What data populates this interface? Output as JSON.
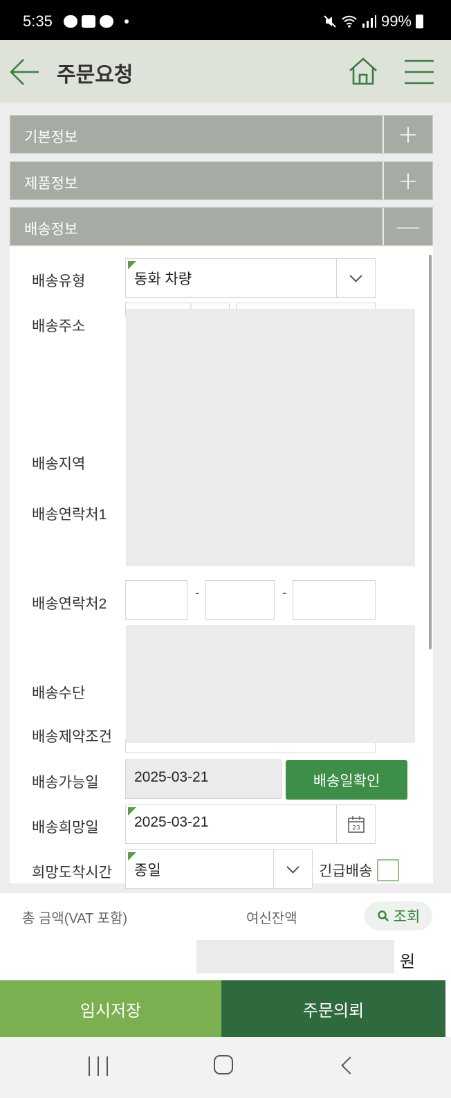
{
  "status_bar": {
    "time": "5:35",
    "battery": "99%"
  },
  "header": {
    "title": "주문요청"
  },
  "sections": [
    {
      "label": "기본정보",
      "toggle": "+"
    },
    {
      "label": "제품정보",
      "toggle": "+"
    },
    {
      "label": "배송정보",
      "toggle": "—"
    }
  ],
  "fields": {
    "delivery_type": {
      "label": "배송유형",
      "value": "동화 차량"
    },
    "address": {
      "label": "배송주소"
    },
    "region": {
      "label": "배송지역"
    },
    "contact1": {
      "label": "배송연락처1"
    },
    "contact2": {
      "label": "배송연락처2",
      "sep": "-"
    },
    "method": {
      "label": "배송수단"
    },
    "constraint": {
      "label": "배송제약조건"
    },
    "available_date": {
      "label": "배송가능일",
      "value": "2025-03-21",
      "button": "배송일확인"
    },
    "desired_date": {
      "label": "배송희망일",
      "value": "2025-03-21",
      "calendar_day": "23"
    },
    "arrival_time": {
      "label": "희망도착시간",
      "value": "종일"
    },
    "urgent": {
      "label": "긴급배송"
    }
  },
  "totals": {
    "total_label": "총 금액(VAT 포함)",
    "credit_label": "여신잔액",
    "query_label": "조회",
    "currency": "원"
  },
  "actions": {
    "save": "임시저장",
    "order": "주문의뢰"
  },
  "colors": {
    "accent": "#3d8e47",
    "save": "#7ab04f",
    "order": "#2f6a3e",
    "section": "#a6aca4",
    "header": "#dde3d9"
  }
}
